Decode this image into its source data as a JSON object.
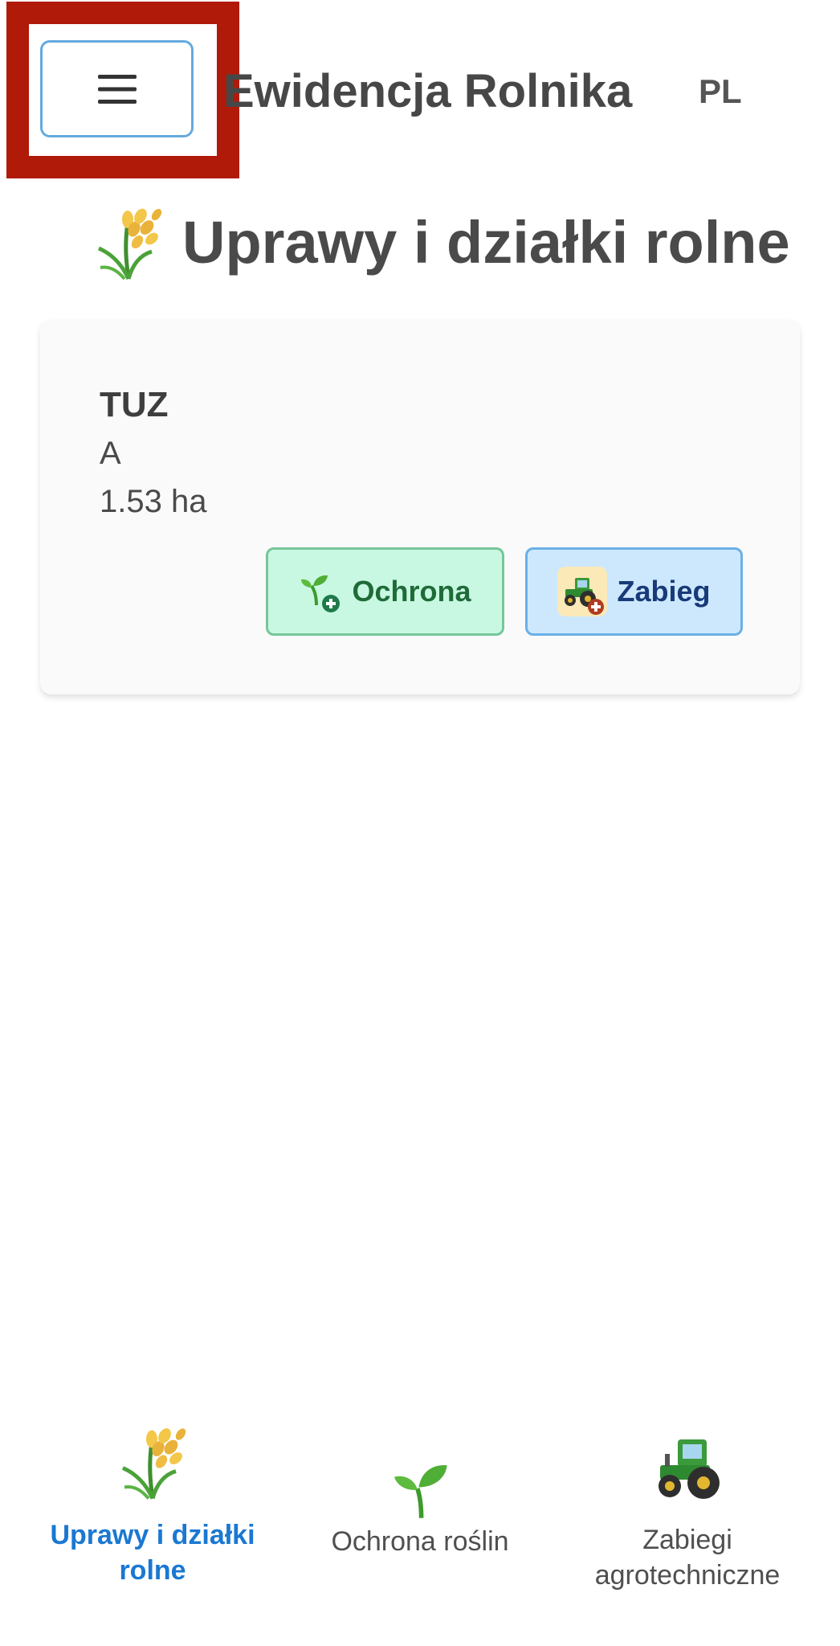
{
  "header": {
    "app_title": "Ewidencja Rolnika",
    "language": "PL",
    "menu_icon": "hamburger-menu-icon",
    "highlight_color": "#b01a08"
  },
  "page": {
    "heading": "Uprawy i działki rolne",
    "heading_icon": "sheaf-of-rice-icon"
  },
  "fields": [
    {
      "name": "TUZ",
      "crop": "A",
      "area": "1.53 ha",
      "actions": {
        "ochrona": {
          "label": "Ochrona",
          "icon": "seedling-plus-icon",
          "color": "#c8f8e2"
        },
        "zabieg": {
          "label": "Zabieg",
          "icon": "tractor-plus-icon",
          "color": "#cde8fd"
        }
      }
    }
  ],
  "bottom_nav": {
    "active_color": "#1a78d2",
    "items": [
      {
        "label": "Uprawy i działki rolne",
        "icon": "sheaf-of-rice-icon",
        "active": true
      },
      {
        "label": "Ochrona roślin",
        "icon": "seedling-icon",
        "active": false
      },
      {
        "label": "Zabiegi agrotechniczne",
        "icon": "tractor-icon",
        "active": false
      }
    ]
  }
}
